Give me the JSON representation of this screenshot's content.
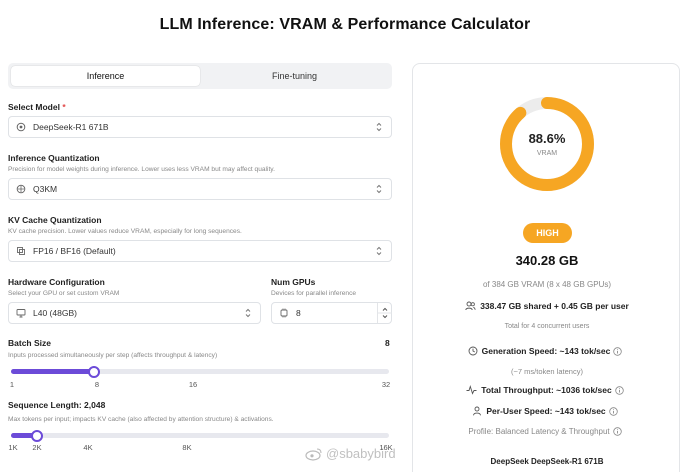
{
  "title": "LLM Inference: VRAM & Performance Calculator",
  "tabs": [
    {
      "label": "Inference",
      "active": true
    },
    {
      "label": "Fine-tuning",
      "active": false
    }
  ],
  "model": {
    "label": "Select Model",
    "required_mark": "*",
    "value": "DeepSeek-R1 671B"
  },
  "inference_quant": {
    "label": "Inference Quantization",
    "help": "Precision for model weights during inference. Lower uses less VRAM but may affect quality.",
    "value": "Q3KM"
  },
  "kv_quant": {
    "label": "KV Cache Quantization",
    "help": "KV cache precision. Lower values reduce VRAM, especially for long sequences.",
    "value": "FP16 / BF16 (Default)"
  },
  "hardware": {
    "label": "Hardware Configuration",
    "help": "Select your GPU or set custom VRAM",
    "value": "L40 (48GB)"
  },
  "num_gpus": {
    "label": "Num GPUs",
    "help": "Devices for parallel inference",
    "value": "8"
  },
  "batch": {
    "label": "Batch Size",
    "value_display": "8",
    "help": "Inputs processed simultaneously per step (affects throughput & latency)",
    "ticks": [
      "1",
      "8",
      "16",
      "32"
    ],
    "fraction": 0.22
  },
  "seq": {
    "label": "Sequence Length: 2,048",
    "help": "Max tokens per input; impacts KV cache (also affected by attention structure) & activations.",
    "ticks": [
      "1K",
      "2K",
      "4K",
      "8K",
      "16K"
    ],
    "fraction": 0.07
  },
  "result": {
    "gauge_percent": "88.6%",
    "gauge_fraction": 0.886,
    "gauge_label": "VRAM",
    "badge": "HIGH",
    "total": "340.28 GB",
    "of_total": "of 384 GB VRAM (8 x 48 GB GPUs)",
    "shared": "338.47 GB shared + 0.45 GB per user",
    "concurrent": "Total for 4 concurrent users",
    "gen_speed": "Generation Speed: ~143 tok/sec",
    "latency": "(~7 ms/token latency)",
    "throughput": "Total Throughput: ~1036 tok/sec",
    "per_user": "Per-User Speed: ~143 tok/sec",
    "profile": "Profile: Balanced Latency & Throughput",
    "model_name": "DeepSeek DeepSeek-R1 671B"
  },
  "colors": {
    "gauge": "#f6a623",
    "slider": "#6c4bd8",
    "badge": "#f6a623"
  },
  "watermark": "@sbabybird"
}
